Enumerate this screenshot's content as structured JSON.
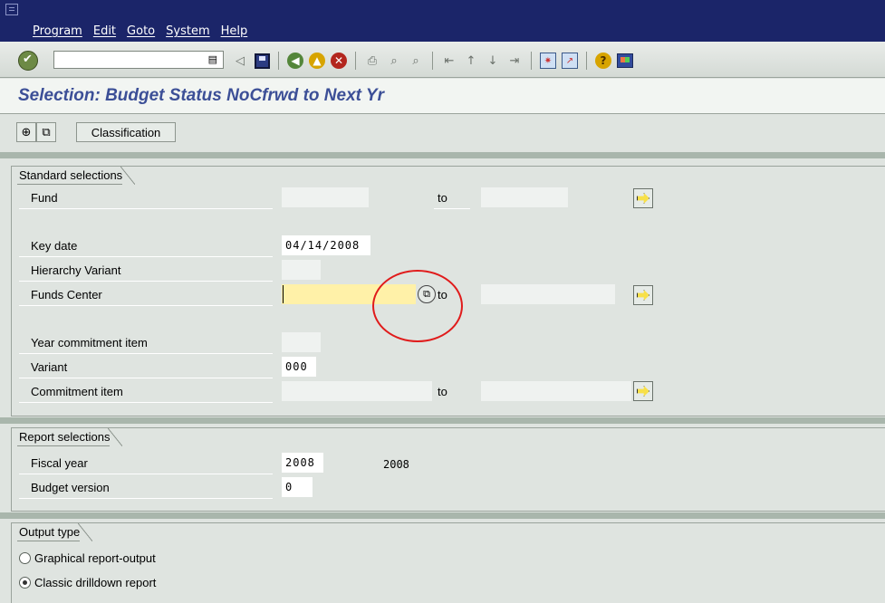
{
  "menu": {
    "items": [
      "Program",
      "Edit",
      "Goto",
      "System",
      "Help"
    ]
  },
  "toolbar": {
    "command_value": "",
    "icons": [
      "enter-icon",
      "history-icon",
      "back-arrow-icon",
      "save-icon",
      "back-icon",
      "exit-icon",
      "cancel-icon",
      "print-icon",
      "find-icon",
      "find-next-icon",
      "first-page-icon",
      "previous-page-icon",
      "next-page-icon",
      "last-page-icon",
      "create-session-icon",
      "shortcut-icon",
      "help-icon",
      "layout-menu-icon"
    ]
  },
  "page": {
    "title": "Selection: Budget Status NoCfrwd to Next Yr"
  },
  "app_toolbar": {
    "classification_label": "Classification"
  },
  "standard": {
    "title": "Standard selections",
    "to": "to",
    "fund_label": "Fund",
    "fund_from": "",
    "fund_to": "",
    "key_date_label": "Key date",
    "key_date_value": "04/14/2008",
    "hierarchy_label": "Hierarchy Variant",
    "hierarchy_value": "",
    "funds_center_label": "Funds Center",
    "funds_center_from": "",
    "funds_center_to": "",
    "year_ci_label": "Year commitment item",
    "year_ci_value": "",
    "variant_label": "Variant",
    "variant_value": "000",
    "commitment_label": "Commitment item",
    "commitment_from": "",
    "commitment_to": ""
  },
  "report": {
    "title": "Report selections",
    "fiscal_year_label": "Fiscal year",
    "fiscal_year_value": "2008",
    "fiscal_year_text": "2008",
    "budget_version_label": "Budget version",
    "budget_version_value": "0"
  },
  "output": {
    "title": "Output type",
    "option1": "Graphical report-output",
    "option2": "Classic drilldown report",
    "selected": "Classic drilldown report"
  }
}
